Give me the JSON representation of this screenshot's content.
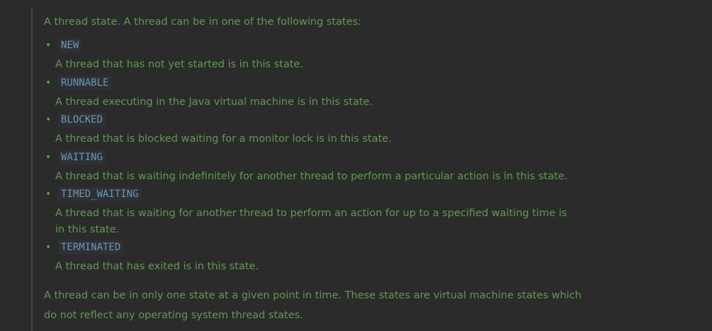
{
  "doc": {
    "intro": "A thread state. A thread can be in one of the following states:",
    "states": [
      {
        "name": "NEW",
        "description": "A thread that has not yet started is in this state."
      },
      {
        "name": "RUNNABLE",
        "description": "A thread executing in the Java virtual machine is in this state."
      },
      {
        "name": "BLOCKED",
        "description": "A thread that is blocked waiting for a monitor lock is in this state."
      },
      {
        "name": "WAITING",
        "description": "A thread that is waiting indefinitely for another thread to perform a particular action is in this state."
      },
      {
        "name": "TIMED_WAITING",
        "description": "A thread that is waiting for another thread to perform an action for up to a specified waiting time is in this state."
      },
      {
        "name": "TERMINATED",
        "description": "A thread that has exited is in this state."
      }
    ],
    "outro": "A thread can be in only one state at a given point in time. These states are virtual machine states which do not reflect any operating system thread states."
  }
}
